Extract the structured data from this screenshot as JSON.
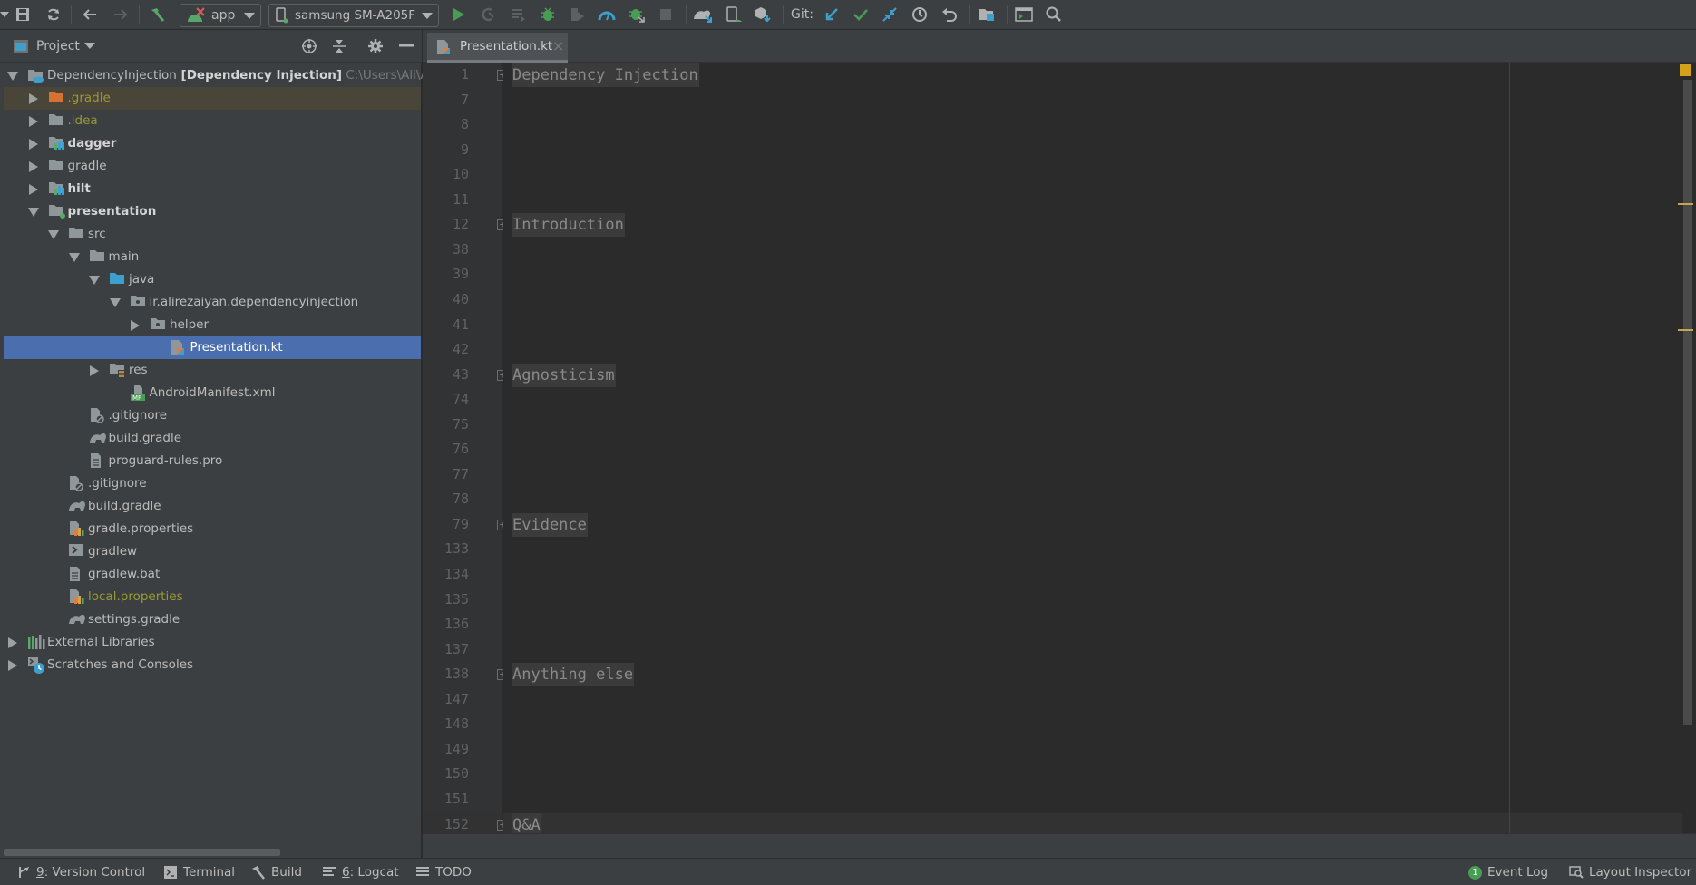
{
  "toolbar": {
    "run_config": "app",
    "device": "samsung SM-A205F",
    "git_label": "Git:",
    "icons": [
      "save-icon",
      "sync-icon",
      "back-icon",
      "forward-icon",
      "build-hammer-icon",
      "run-icon",
      "apply-changes-icon",
      "apply-code-changes-icon",
      "debug-icon",
      "attach-debugger-icon",
      "profile-icon",
      "attach-process-icon",
      "stop-icon",
      "gradle-sync-icon",
      "avd-manager-icon",
      "sdk-manager-icon",
      "git-update-icon",
      "git-commit-icon",
      "git-pull-request-icon",
      "git-history-icon",
      "git-rollback-icon",
      "project-structure-icon",
      "terminal-window-icon",
      "search-everywhere-icon"
    ]
  },
  "project_panel": {
    "title": "Project",
    "tree": [
      {
        "label": "DependencyInjection",
        "bold_suffix": "[Dependency Injection]",
        "path": "C:\\Users\\Ali\\Androi",
        "depth": 0,
        "expanded": true,
        "icon": "project-folder-icon"
      },
      {
        "label": ".gradle",
        "depth": 1,
        "expanded": false,
        "icon": "folder-orange-icon",
        "style": "olive",
        "highlight": true
      },
      {
        "label": ".idea",
        "depth": 1,
        "expanded": false,
        "icon": "folder-icon",
        "style": "olive"
      },
      {
        "label": "dagger",
        "depth": 1,
        "expanded": false,
        "icon": "module-folder-icon",
        "style": "bold"
      },
      {
        "label": "gradle",
        "depth": 1,
        "expanded": false,
        "icon": "folder-icon"
      },
      {
        "label": "hilt",
        "depth": 1,
        "expanded": false,
        "icon": "module-folder-icon",
        "style": "bold"
      },
      {
        "label": "presentation",
        "depth": 1,
        "expanded": true,
        "icon": "android-module-folder-icon",
        "style": "bold"
      },
      {
        "label": "src",
        "depth": 2,
        "expanded": true,
        "icon": "folder-icon"
      },
      {
        "label": "main",
        "depth": 3,
        "expanded": true,
        "icon": "folder-icon"
      },
      {
        "label": "java",
        "depth": 4,
        "expanded": true,
        "icon": "source-folder-icon"
      },
      {
        "label": "ir.alirezaiyan.dependencyinjection",
        "depth": 5,
        "expanded": true,
        "icon": "package-icon"
      },
      {
        "label": "helper",
        "depth": 6,
        "expanded": false,
        "icon": "package-icon"
      },
      {
        "label": "Presentation.kt",
        "depth": 7,
        "icon": "kotlin-file-icon",
        "selected": true
      },
      {
        "label": "res",
        "depth": 4,
        "expanded": false,
        "icon": "resources-folder-icon"
      },
      {
        "label": "AndroidManifest.xml",
        "depth": 5,
        "icon": "manifest-file-icon"
      },
      {
        "label": ".gitignore",
        "depth": 3,
        "icon": "gitignore-file-icon"
      },
      {
        "label": "build.gradle",
        "depth": 3,
        "icon": "gradle-file-icon"
      },
      {
        "label": "proguard-rules.pro",
        "depth": 3,
        "icon": "text-file-icon"
      },
      {
        "label": ".gitignore",
        "depth": 2,
        "icon": "gitignore-file-icon"
      },
      {
        "label": "build.gradle",
        "depth": 2,
        "icon": "gradle-file-icon"
      },
      {
        "label": "gradle.properties",
        "depth": 2,
        "icon": "properties-file-icon"
      },
      {
        "label": "gradlew",
        "depth": 2,
        "icon": "shell-script-icon"
      },
      {
        "label": "gradlew.bat",
        "depth": 2,
        "icon": "text-file-icon"
      },
      {
        "label": "local.properties",
        "depth": 2,
        "icon": "properties-file-icon",
        "style": "olive"
      },
      {
        "label": "settings.gradle",
        "depth": 2,
        "icon": "gradle-file-icon"
      },
      {
        "label": "External Libraries",
        "depth": 0,
        "expanded": false,
        "icon": "libraries-icon"
      },
      {
        "label": "Scratches and Consoles",
        "depth": 0,
        "expanded": false,
        "icon": "scratches-icon"
      }
    ]
  },
  "editor": {
    "tab_label": "Presentation.kt",
    "line_numbers": [
      "1",
      "7",
      "8",
      "9",
      "10",
      "11",
      "12",
      "38",
      "39",
      "40",
      "41",
      "42",
      "43",
      "74",
      "75",
      "76",
      "77",
      "78",
      "79",
      "133",
      "134",
      "135",
      "136",
      "137",
      "138",
      "147",
      "148",
      "149",
      "150",
      "151",
      "152"
    ],
    "folded_lines": [
      {
        "line_index": 0,
        "text": "Dependency Injection"
      },
      {
        "line_index": 6,
        "text": "Introduction"
      },
      {
        "line_index": 12,
        "text": "Agnosticism"
      },
      {
        "line_index": 18,
        "text": "Evidence"
      },
      {
        "line_index": 24,
        "text": "Anything else"
      },
      {
        "line_index": 30,
        "text": "Q&A"
      }
    ],
    "caret_line_index": 30,
    "colors": {
      "warning": "#d4a21a",
      "selection": "#4b6eaf"
    }
  },
  "statusbar": {
    "left": [
      {
        "key": "9",
        "label": ": Version Control",
        "icon": "version-control-icon"
      },
      {
        "key": "",
        "label": "Terminal",
        "icon": "terminal-icon"
      },
      {
        "key": "",
        "label": "Build",
        "icon": "build-hammer-icon"
      },
      {
        "key": "6",
        "label": ": Logcat",
        "icon": "logcat-icon"
      },
      {
        "key": "",
        "label": "TODO",
        "icon": "todo-icon"
      }
    ],
    "right": [
      {
        "label": "Event Log",
        "badge": "1",
        "icon": "event-log-icon"
      },
      {
        "label": "Layout Inspector",
        "icon": "layout-inspector-icon"
      }
    ]
  }
}
